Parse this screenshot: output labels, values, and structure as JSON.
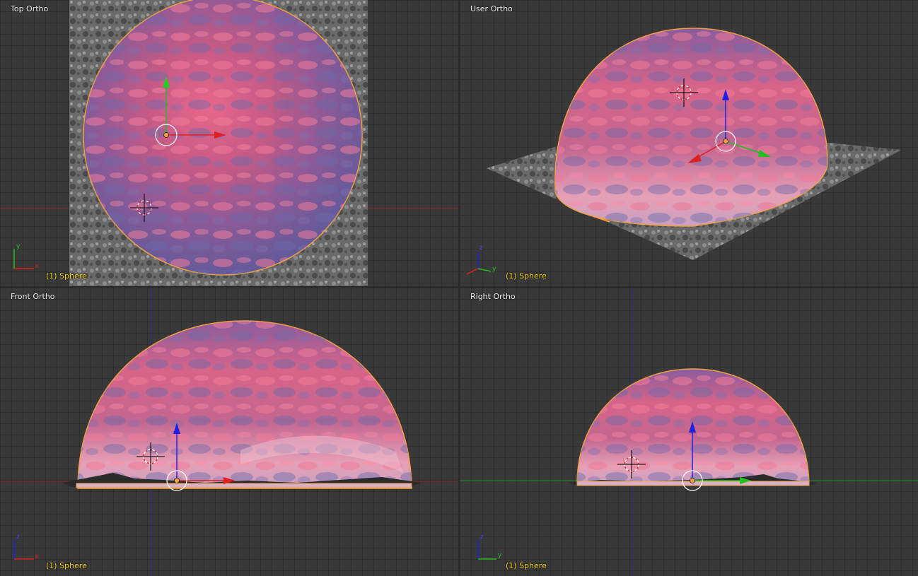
{
  "viewports": [
    {
      "title": "Top Ortho",
      "object_label": "(1) Sphere",
      "axes": [
        "y",
        "x"
      ]
    },
    {
      "title": "User Ortho",
      "object_label": "(1) Sphere",
      "axes": [
        "z",
        "y",
        "x"
      ]
    },
    {
      "title": "Front Ortho",
      "object_label": "(1) Sphere",
      "axes": [
        "z",
        "x"
      ]
    },
    {
      "title": "Right Ortho",
      "object_label": "(1) Sphere",
      "axes": [
        "z",
        "y"
      ]
    }
  ],
  "colors": {
    "background": "#393939",
    "axis_x": "#e02020",
    "axis_y": "#20c020",
    "axis_z": "#2020e0",
    "selection_outline": "#f0a040",
    "object_label": "#f0d020"
  },
  "icons": [
    "3d-cursor-icon",
    "transform-gizmo-icon",
    "axis-orientation-icon"
  ]
}
